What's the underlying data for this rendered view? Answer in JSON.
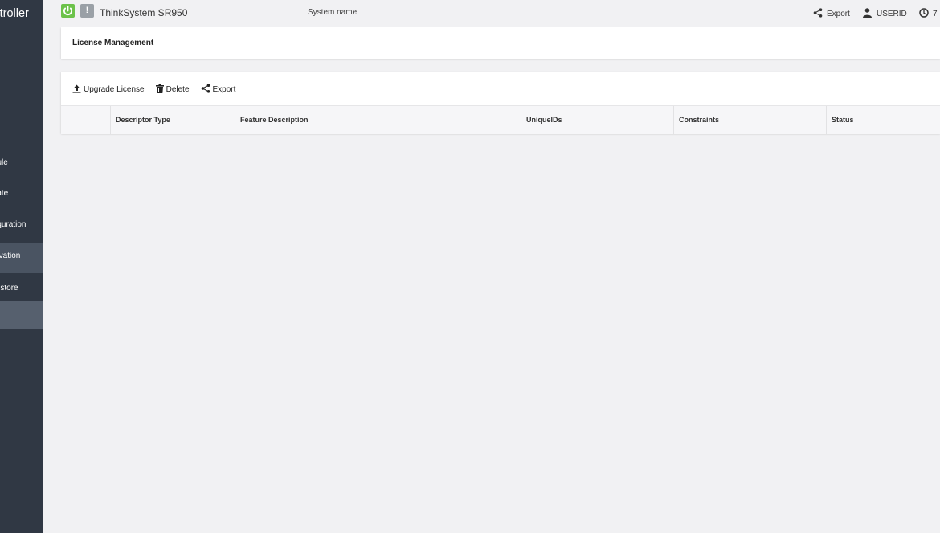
{
  "sidebar": {
    "brand": "Controller",
    "items": [
      {
        "label": "Module"
      },
      {
        "label": "Update"
      },
      {
        "label": "Configuration"
      },
      {
        "label": "Activation"
      },
      {
        "label": "Backup and Restore"
      },
      {
        "label": ""
      }
    ]
  },
  "topbar": {
    "product": "ThinkSystem SR950",
    "system_name_label": "System name:",
    "export_label": "Export",
    "user_label": "USERID",
    "clock_label": "7"
  },
  "header": {
    "title": "License Management"
  },
  "toolbar": {
    "upgrade_label": "Upgrade License",
    "delete_label": "Delete",
    "export_label": "Export"
  },
  "table": {
    "columns": [
      "Descriptor Type",
      "Feature Description",
      "UniqueIDs",
      "Constraints",
      "Status"
    ],
    "rows": []
  },
  "colors": {
    "power_green": "#6cc24a",
    "sidebar_bg": "#303844"
  }
}
